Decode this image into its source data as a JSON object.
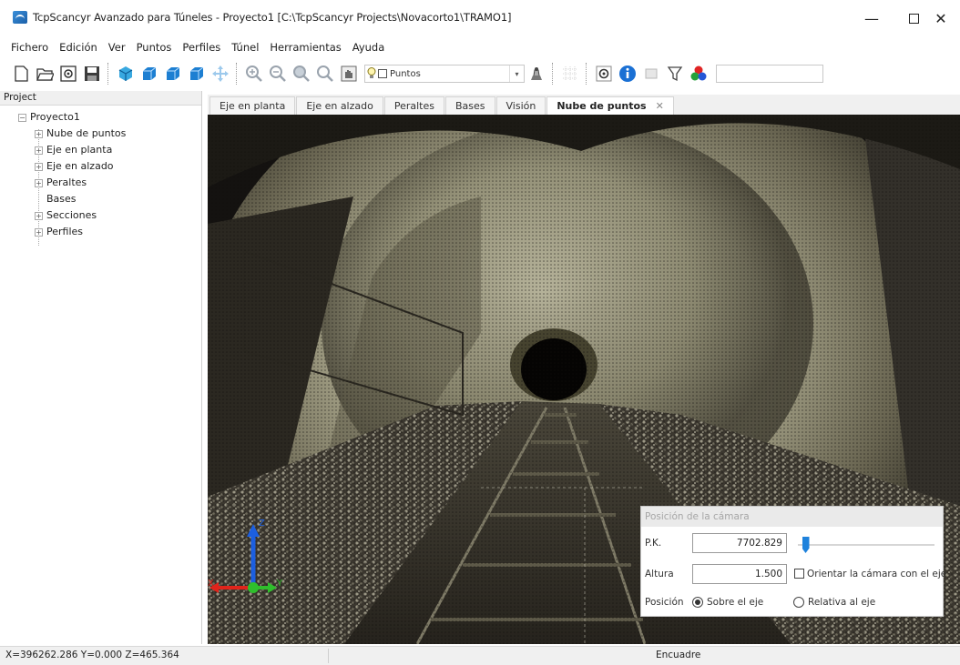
{
  "window": {
    "title": "TcpScancyr Avanzado para Túneles - Proyecto1 [C:\\TcpScancyr Projects\\Novacorto1\\TRAMO1]",
    "min_glyph": "—",
    "close_glyph": "✕"
  },
  "menu": [
    "Fichero",
    "Edición",
    "Ver",
    "Puntos",
    "Perfiles",
    "Túnel",
    "Herramientas",
    "Ayuda"
  ],
  "toolbar": {
    "combo_label": "Puntos",
    "combo_arrow": "▾",
    "icons": [
      "new-file-icon",
      "open-folder-icon",
      "settings-disk-icon",
      "save-icon",
      "cube-view-icon",
      "wireframe-box-icon",
      "blue-box-icon",
      "blue-box-alt-icon",
      "pan-cross-icon",
      "zoom-in-icon",
      "zoom-out-icon",
      "zoom-window-icon",
      "zoom-extent-icon",
      "hand-pan-icon",
      "light-bulb-icon",
      "scanner-icon",
      "grid-icon",
      "target-gear-icon",
      "info-icon",
      "panel-icon",
      "filter-icon",
      "color-palette-icon"
    ]
  },
  "project_panel": {
    "header": "Project",
    "root": "Proyecto1",
    "root_expander": "−",
    "expander": "+",
    "items": [
      {
        "label": "Nube de puntos",
        "expandable": true
      },
      {
        "label": "Eje en planta",
        "expandable": true
      },
      {
        "label": "Eje en alzado",
        "expandable": true
      },
      {
        "label": "Peraltes",
        "expandable": true
      },
      {
        "label": "Bases",
        "expandable": false
      },
      {
        "label": "Secciones",
        "expandable": true
      },
      {
        "label": "Perfiles",
        "expandable": true
      }
    ]
  },
  "tabs": [
    {
      "label": "Eje en planta",
      "active": false
    },
    {
      "label": "Eje en alzado",
      "active": false
    },
    {
      "label": "Peraltes",
      "active": false
    },
    {
      "label": "Bases",
      "active": false
    },
    {
      "label": "Visión",
      "active": false
    },
    {
      "label": "Nube de puntos",
      "active": true,
      "close": "✕"
    }
  ],
  "camera_dialog": {
    "title": "Posición de la cámara",
    "pk_label": "P.K.",
    "pk_value": "7702.829",
    "height_label": "Altura",
    "height_value": "1.500",
    "orient_label": "Orientar la cámara con el eje",
    "orient_checked": false,
    "position_label": "Posición",
    "option_on_axis": "Sobre el eje",
    "option_relative": "Relativa al eje",
    "selected_option": "Sobre el eje",
    "slider_fraction": 0.03
  },
  "axes": {
    "x_label": "X",
    "y_label": "Y",
    "z_label": "Z"
  },
  "colors": {
    "axis_x": "#e0241b",
    "axis_y": "#2fbf2c",
    "axis_z": "#1c5fe0",
    "accent_blue": "#1e82dc",
    "tunnel_light": "#c9c7a8",
    "tunnel_dark": "#191612"
  },
  "status": {
    "coords": "X=396262.286 Y=0.000 Z=465.364",
    "mode": "Encuadre"
  }
}
